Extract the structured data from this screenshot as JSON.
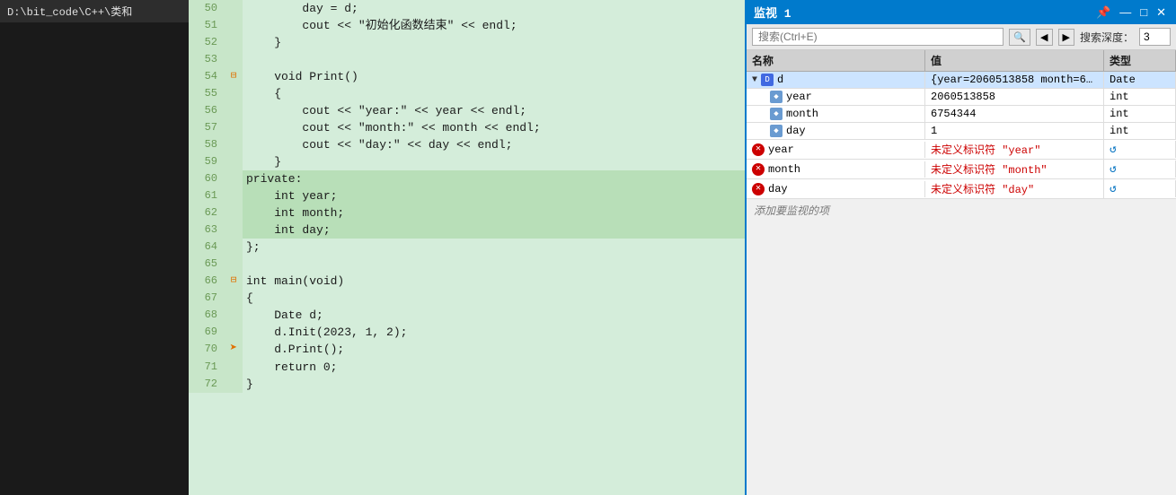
{
  "sidebar": {
    "title": "D:\\bit_code\\C++\\类和"
  },
  "editor": {
    "lines": [
      {
        "num": 50,
        "gutter": "",
        "code": "        day = d;",
        "highlight": false,
        "arrow": false
      },
      {
        "num": 51,
        "gutter": "",
        "code": "        cout << \"初始化函数结束\" << endl;",
        "highlight": false,
        "arrow": false
      },
      {
        "num": 52,
        "gutter": "",
        "code": "    }",
        "highlight": false,
        "arrow": false
      },
      {
        "num": 53,
        "gutter": "",
        "code": "",
        "highlight": false,
        "arrow": false
      },
      {
        "num": 54,
        "gutter": "⊟",
        "code": "    void Print()",
        "highlight": false,
        "arrow": false
      },
      {
        "num": 55,
        "gutter": "",
        "code": "    {",
        "highlight": false,
        "arrow": false
      },
      {
        "num": 56,
        "gutter": "",
        "code": "        cout << \"year:\" << year << endl;",
        "highlight": false,
        "arrow": false
      },
      {
        "num": 57,
        "gutter": "",
        "code": "        cout << \"month:\" << month << endl;",
        "highlight": false,
        "arrow": false
      },
      {
        "num": 58,
        "gutter": "",
        "code": "        cout << \"day:\" << day << endl;",
        "highlight": false,
        "arrow": false
      },
      {
        "num": 59,
        "gutter": "",
        "code": "    }",
        "highlight": false,
        "arrow": false
      },
      {
        "num": 60,
        "gutter": "",
        "code": "private:",
        "highlight": true,
        "arrow": false
      },
      {
        "num": 61,
        "gutter": "",
        "code": "    int year;",
        "highlight": true,
        "arrow": false
      },
      {
        "num": 62,
        "gutter": "",
        "code": "    int month;",
        "highlight": true,
        "arrow": false
      },
      {
        "num": 63,
        "gutter": "",
        "code": "    int day;",
        "highlight": true,
        "arrow": false
      },
      {
        "num": 64,
        "gutter": "",
        "code": "};",
        "highlight": false,
        "arrow": false
      },
      {
        "num": 65,
        "gutter": "",
        "code": "",
        "highlight": false,
        "arrow": false
      },
      {
        "num": 66,
        "gutter": "⊟",
        "code": "int main(void)",
        "highlight": false,
        "arrow": false
      },
      {
        "num": 67,
        "gutter": "",
        "code": "{",
        "highlight": false,
        "arrow": false
      },
      {
        "num": 68,
        "gutter": "",
        "code": "    Date d;",
        "highlight": false,
        "arrow": false
      },
      {
        "num": 69,
        "gutter": "",
        "code": "    d.Init(2023, 1, 2);",
        "highlight": false,
        "arrow": false
      },
      {
        "num": 70,
        "gutter": "",
        "code": "    d.Print();",
        "highlight": false,
        "arrow": true
      },
      {
        "num": 71,
        "gutter": "",
        "code": "    return 0;",
        "highlight": false,
        "arrow": false
      },
      {
        "num": 72,
        "gutter": "",
        "code": "}",
        "highlight": false,
        "arrow": false
      }
    ]
  },
  "watch": {
    "title": "监视 1",
    "search_placeholder": "搜索(Ctrl+E)",
    "search_depth_label": "搜索深度：",
    "search_depth_value": "3",
    "columns": {
      "name": "名称",
      "value": "值",
      "type": "类型"
    },
    "rows": [
      {
        "level": 0,
        "expanded": true,
        "icon": "obj",
        "name": "d",
        "value": "{year=2060513858 month=6754...",
        "type": "Date",
        "selected": true,
        "error": false
      },
      {
        "level": 1,
        "expanded": false,
        "icon": "field",
        "name": "year",
        "value": "2060513858",
        "type": "int",
        "selected": false,
        "error": false
      },
      {
        "level": 1,
        "expanded": false,
        "icon": "field",
        "name": "month",
        "value": "6754344",
        "type": "int",
        "selected": false,
        "error": false
      },
      {
        "level": 1,
        "expanded": false,
        "icon": "field",
        "name": "day",
        "value": "1",
        "type": "int",
        "selected": false,
        "error": false
      },
      {
        "level": 0,
        "expanded": false,
        "icon": "error",
        "name": "year",
        "value": "未定义标识符 \"year\"",
        "type": "",
        "selected": false,
        "error": true,
        "refresh": true
      },
      {
        "level": 0,
        "expanded": false,
        "icon": "error",
        "name": "month",
        "value": "未定义标识符 \"month\"",
        "type": "",
        "selected": false,
        "error": true,
        "refresh": true
      },
      {
        "level": 0,
        "expanded": false,
        "icon": "error",
        "name": "day",
        "value": "未定义标识符 \"day\"",
        "type": "",
        "selected": false,
        "error": true,
        "refresh": true
      }
    ],
    "add_watch_text": "添加要监视的项"
  }
}
